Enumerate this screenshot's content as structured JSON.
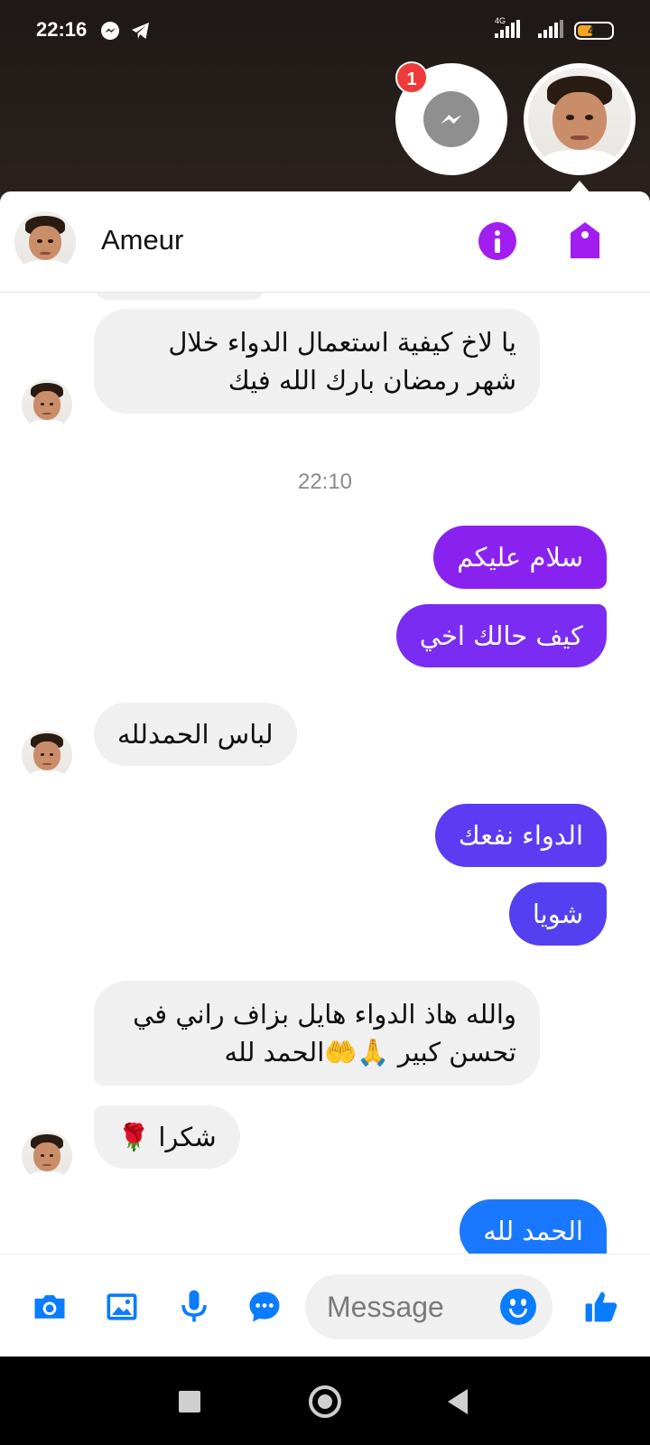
{
  "status_bar": {
    "time": "22:16",
    "network_label": "4G",
    "battery": "46"
  },
  "chat_heads": {
    "badge_count": "1"
  },
  "conversation": {
    "contact_name": "Ameur"
  },
  "messages": [
    {
      "id": "m1",
      "direction": "in",
      "text": "يا لاخ كيفية استعمال الدواء خلال شهر رمضان بارك الله فيك"
    },
    {
      "id": "t1",
      "direction": "timestamp",
      "text": "22:10"
    },
    {
      "id": "m2",
      "direction": "out",
      "text": "سلام عليكم",
      "color": "#8a22ef"
    },
    {
      "id": "m3",
      "direction": "out",
      "text": "كيف حالك اخي",
      "color": "#7a2cf2"
    },
    {
      "id": "m4",
      "direction": "in",
      "text": "لباس الحمدلله"
    },
    {
      "id": "m5",
      "direction": "out",
      "text": "الدواء نفعك",
      "color": "#5b3cf2"
    },
    {
      "id": "m6",
      "direction": "out",
      "text": "شويا",
      "color": "#5440f0"
    },
    {
      "id": "m7",
      "direction": "in",
      "text": "والله هاذ الدواء هايل بزاف راني في تحسن كبير 🙏🤲الحمد لله"
    },
    {
      "id": "m8",
      "direction": "in",
      "text": "شكرا 🌹"
    },
    {
      "id": "m9",
      "direction": "out",
      "text": "الحمد لله",
      "color": "#1a77ff"
    }
  ],
  "composer": {
    "placeholder": "Message"
  },
  "colors": {
    "accent": "#0a7cff",
    "header_icons": "#a21ef0",
    "incoming_bubble": "#f0f0f0"
  },
  "icons": [
    "messenger-icon",
    "telegram-icon",
    "info-icon",
    "tag-icon",
    "camera-icon",
    "gallery-icon",
    "microphone-icon",
    "chat-icon",
    "emoji-icon",
    "thumbs-up-icon"
  ]
}
